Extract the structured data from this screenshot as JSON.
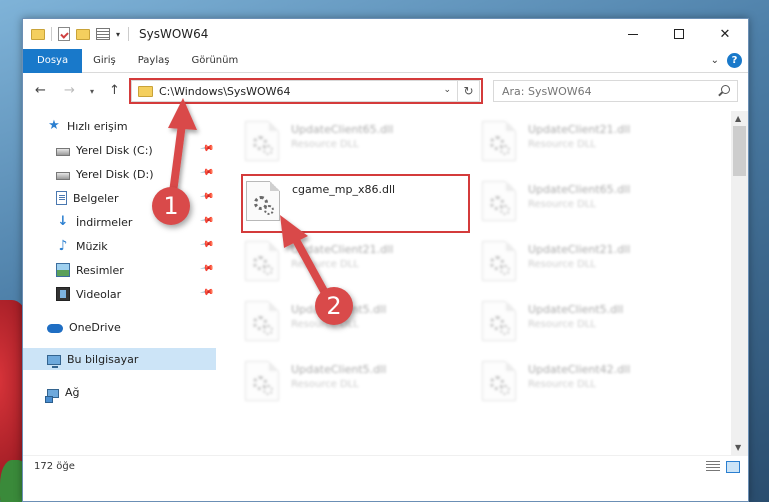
{
  "window": {
    "title": "SysWOW64",
    "controls": {
      "minimize": "—",
      "maximize": "☐",
      "close": "✕"
    }
  },
  "ribbon": {
    "tabs": [
      {
        "label": "Dosya",
        "active": true
      },
      {
        "label": "Giriş"
      },
      {
        "label": "Paylaş"
      },
      {
        "label": "Görünüm"
      }
    ],
    "help": "?"
  },
  "addressbar": {
    "path": "C:\\Windows\\SysWOW64",
    "refresh": "↻"
  },
  "search": {
    "placeholder": "Ara: SysWOW64"
  },
  "nav": {
    "items": [
      {
        "label": "Hızlı erişim",
        "icon": "star-icon"
      },
      {
        "label": "Yerel Disk (C:)",
        "icon": "disk-icon",
        "pinned": true
      },
      {
        "label": "Yerel Disk (D:)",
        "icon": "disk-icon",
        "pinned": true
      },
      {
        "label": "Belgeler",
        "icon": "documents-icon",
        "pinned": true
      },
      {
        "label": "İndirmeler",
        "icon": "download-icon",
        "pinned": true
      },
      {
        "label": "Müzik",
        "icon": "music-icon",
        "pinned": true
      },
      {
        "label": "Resimler",
        "icon": "pictures-icon",
        "pinned": true
      },
      {
        "label": "Videolar",
        "icon": "videos-icon",
        "pinned": true
      },
      {
        "label": "OneDrive",
        "icon": "cloud-icon"
      },
      {
        "label": "Bu bilgisayar",
        "icon": "computer-icon",
        "selected": true
      },
      {
        "label": "Ağ",
        "icon": "network-icon"
      }
    ]
  },
  "files": [
    {
      "name": "UpdateClient65.dll",
      "desc": "Resource DLL"
    },
    {
      "name": "UpdateClient21.dll",
      "desc": "Resource DLL"
    },
    {
      "name": "cgame_mp_x86.dll",
      "desc": ""
    },
    {
      "name": "UpdateClient65.dll",
      "desc": "Resource DLL"
    },
    {
      "name": "UpdateClient21.dll",
      "desc": "Resource DLL"
    },
    {
      "name": "UpdateClient21.dll",
      "desc": "Resource DLL"
    },
    {
      "name": "UpdateClient5.dll",
      "desc": "Resource DLL"
    },
    {
      "name": "UpdateClient5.dll",
      "desc": "Resource DLL"
    },
    {
      "name": "UpdateClient5.dll",
      "desc": "Resource DLL"
    },
    {
      "name": "UpdateClient42.dll",
      "desc": "Resource DLL"
    }
  ],
  "status": {
    "count": "172 öğe"
  },
  "annotations": {
    "step1": "1",
    "step2": "2",
    "color": "#d94a4a"
  }
}
